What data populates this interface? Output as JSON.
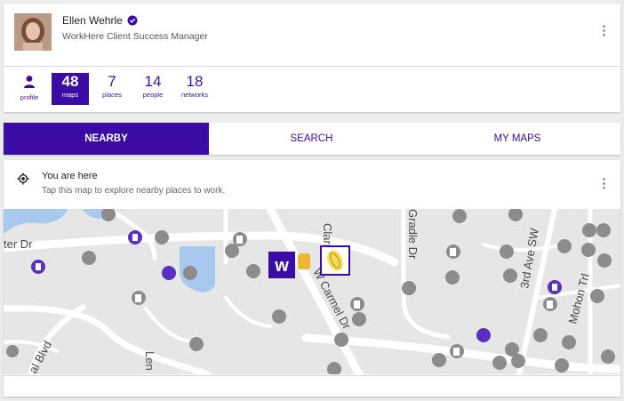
{
  "profile": {
    "name": "Ellen Wehrle",
    "title": "WorkHere Client Success Manager",
    "stats": [
      {
        "value": "",
        "label": "profile",
        "icon": "person-icon"
      },
      {
        "value": "48",
        "label": "maps",
        "active": true
      },
      {
        "value": "7",
        "label": "places"
      },
      {
        "value": "14",
        "label": "people"
      },
      {
        "value": "18",
        "label": "networks"
      }
    ]
  },
  "tabs": [
    {
      "label": "NEARBY",
      "active": true
    },
    {
      "label": "SEARCH"
    },
    {
      "label": "MY MAPS"
    }
  ],
  "location": {
    "title": "You are here",
    "subtitle": "Tap this map to explore nearby places to work."
  },
  "map": {
    "streets": [
      "ter Dr",
      "Clari",
      "Gradle Dr",
      "3rd Ave SW",
      "Mohon Trl",
      "W Carmel Dr",
      "al Blvd",
      "Len"
    ],
    "logo_text": "w"
  },
  "colors": {
    "accent": "#3a0ca3",
    "map_bg": "#e6e6e6",
    "water": "#a8c8f0",
    "road": "#ffffff",
    "poi": "#8c8c8c"
  }
}
